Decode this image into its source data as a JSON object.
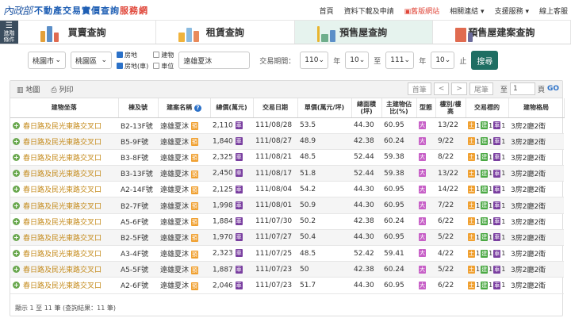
{
  "header": {
    "logo_mark": "內政部",
    "title_main": "不動產交易實價查詢",
    "title_sub": "服務網",
    "nav": [
      "首頁",
      "資料下載及申請",
      "舊版網站",
      "相關連結",
      "支援服務",
      "線上客服"
    ]
  },
  "side_button": {
    "line1": "進階",
    "line2": "條件"
  },
  "tabs": [
    "買賣查詢",
    "租賃查詢",
    "預售屋查詢",
    "預售屋建案查詢"
  ],
  "filters": {
    "city": "桃園市",
    "district": "桃園區",
    "types": [
      "房地",
      "建物",
      "房地(車)",
      "車位"
    ],
    "keyword_placeholder": "遠雄夏沐",
    "period_label": "交易期間：",
    "from_year": "110",
    "from_month": "10",
    "to_label": "至",
    "to_year": "111",
    "to_month": "10",
    "year_unit": "年",
    "until": "止",
    "search": "搜尋"
  },
  "toolbar": {
    "map": "地圖",
    "print": "列印",
    "first": "首筆",
    "prev": "<",
    "next": ">",
    "last": "尾筆",
    "to": "至",
    "page": "1",
    "page_unit": "頁",
    "go": "GO"
  },
  "columns": [
    "建物坐落",
    "棟及號",
    "建案名稱",
    "總價(萬元)",
    "交易日期",
    "單價(萬元/坪)",
    "總面積(坪)",
    "主建物佔比(%)",
    "型態",
    "樓別/樓高",
    "交易標的",
    "建物格局"
  ],
  "rows": [
    {
      "addr": "春日路及民光東路交叉口",
      "unit": "B2-13F號",
      "name": "遠雄夏沐",
      "total": "2,110",
      "date": "111/08/28",
      "price": "53.5",
      "area": "44.30",
      "ratio": "60.95",
      "floor": "13/22",
      "layout": "3房2廳2衛"
    },
    {
      "addr": "春日路及民光東路交叉口",
      "unit": "B5-9F號",
      "name": "遠雄夏沐",
      "total": "1,840",
      "date": "111/08/27",
      "price": "48.9",
      "area": "42.38",
      "ratio": "60.24",
      "floor": "9/22",
      "layout": "3房2廳2衛"
    },
    {
      "addr": "春日路及民光東路交叉口",
      "unit": "B3-8F號",
      "name": "遠雄夏沐",
      "total": "2,325",
      "date": "111/08/21",
      "price": "48.5",
      "area": "52.44",
      "ratio": "59.38",
      "floor": "8/22",
      "layout": "3房2廳2衛"
    },
    {
      "addr": "春日路及民光東路交叉口",
      "unit": "B3-13F號",
      "name": "遠雄夏沐",
      "total": "2,450",
      "date": "111/08/17",
      "price": "51.8",
      "area": "52.44",
      "ratio": "59.38",
      "floor": "13/22",
      "layout": "3房2廳2衛"
    },
    {
      "addr": "春日路及民光東路交叉口",
      "unit": "A2-14F號",
      "name": "遠雄夏沐",
      "total": "2,125",
      "date": "111/08/04",
      "price": "54.2",
      "area": "44.30",
      "ratio": "60.95",
      "floor": "14/22",
      "layout": "3房2廳2衛"
    },
    {
      "addr": "春日路及民光東路交叉口",
      "unit": "B2-7F號",
      "name": "遠雄夏沐",
      "total": "1,998",
      "date": "111/08/01",
      "price": "50.9",
      "area": "44.30",
      "ratio": "60.95",
      "floor": "7/22",
      "layout": "3房2廳2衛"
    },
    {
      "addr": "春日路及民光東路交叉口",
      "unit": "A5-6F號",
      "name": "遠雄夏沐",
      "total": "1,884",
      "date": "111/07/30",
      "price": "50.2",
      "area": "42.38",
      "ratio": "60.24",
      "floor": "6/22",
      "layout": "3房2廳2衛"
    },
    {
      "addr": "春日路及民光東路交叉口",
      "unit": "B2-5F號",
      "name": "遠雄夏沐",
      "total": "1,970",
      "date": "111/07/27",
      "price": "50.4",
      "area": "44.30",
      "ratio": "60.95",
      "floor": "5/22",
      "layout": "3房2廳2衛"
    },
    {
      "addr": "春日路及民光東路交叉口",
      "unit": "A3-4F號",
      "name": "遠雄夏沐",
      "total": "2,323",
      "date": "111/07/25",
      "price": "48.5",
      "area": "52.42",
      "ratio": "59.41",
      "floor": "4/22",
      "layout": "3房2廳2衛"
    },
    {
      "addr": "春日路及民光東路交叉口",
      "unit": "A5-5F號",
      "name": "遠雄夏沐",
      "total": "1,887",
      "date": "111/07/23",
      "price": "50",
      "area": "42.38",
      "ratio": "60.24",
      "floor": "5/22",
      "layout": "3房2廳2衛"
    },
    {
      "addr": "春日路及民光東路交叉口",
      "unit": "A2-6F號",
      "name": "遠雄夏沐",
      "total": "2,046",
      "date": "111/07/23",
      "price": "51.7",
      "area": "44.30",
      "ratio": "60.95",
      "floor": "6/22",
      "layout": "3房2廳2衛"
    }
  ],
  "badges": {
    "pre": "預",
    "car": "車",
    "type": "大",
    "land": "土",
    "bld": "建",
    "park": "車",
    "one": "1"
  },
  "footer": "顯示 1 至 11 筆 (查詢結果：11 筆)"
}
